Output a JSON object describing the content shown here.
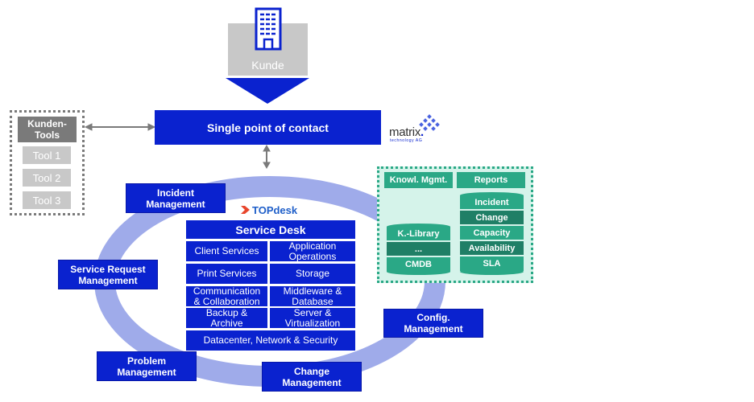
{
  "customer": {
    "icon": "office-building-icon",
    "label": "Kunde"
  },
  "spoc": {
    "label": "Single point of contact"
  },
  "vendor_logo": {
    "name": "matrix",
    "dot": ".",
    "tagline": "technology AG",
    "icon": "diamond-dots-icon"
  },
  "customer_tools": {
    "header_line1": "Kunden-",
    "header_line2": "Tools",
    "items": [
      "Tool 1",
      "Tool 2",
      "Tool 3"
    ]
  },
  "topdesk_logo": {
    "label": "TOPdesk",
    "icon": "chevron-right-icon"
  },
  "service_desk": {
    "title": "Service Desk",
    "rows": [
      [
        "Client Services",
        "Application\nOperations"
      ],
      [
        "Print Services",
        "Storage"
      ],
      [
        "Communication\n& Collaboration",
        "Middleware &\nDatabase"
      ],
      [
        "Backup &\nArchive",
        "Server &\nVirtualization"
      ]
    ],
    "footer": "Datacenter, Network & Security"
  },
  "processes": {
    "incident": "Incident\nManagement",
    "service_request": "Service Request\nManagement",
    "problem": "Problem\nManagement",
    "change": "Change\nManagement",
    "config": "Config.\nManagement"
  },
  "knowledge_panel": {
    "knowl_header": "Knowl. Mgmt.",
    "reports_header": "Reports",
    "knowl_stack": [
      "K.-Library",
      "...",
      "CMDB"
    ],
    "reports_stack": [
      "Incident",
      "Change",
      "Capacity",
      "Availability",
      "SLA"
    ]
  },
  "colors": {
    "primary_blue": "#0a22cf",
    "ring": "#9fabea",
    "gray": "#c8c8c8",
    "dark_gray": "#7a7a7a",
    "green": "#2aa886",
    "dark_green": "#1f7f66",
    "mint": "#d5f3ea",
    "topdesk_red": "#e8452c"
  }
}
